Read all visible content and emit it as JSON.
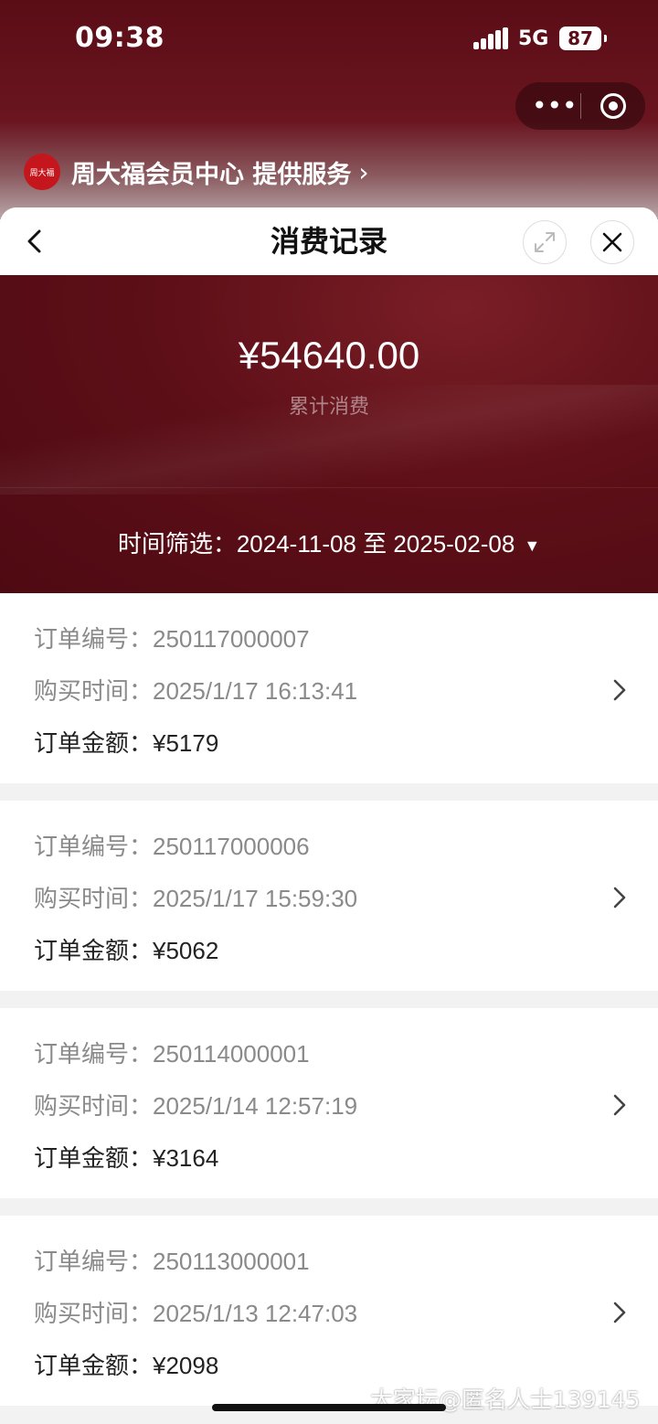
{
  "status_bar": {
    "time": "09:38",
    "network": "5G",
    "battery": "87"
  },
  "provider": {
    "logo_text": "周大福",
    "text": "周大福会员中心 提供服务"
  },
  "navbar": {
    "title": "消费记录"
  },
  "summary": {
    "amount": "¥54640.00",
    "label": "累计消费",
    "filter_label": "时间筛选：",
    "filter_range": "2024-11-08 至 2025-02-08"
  },
  "labels": {
    "order_no": "订单编号：",
    "purchase_time": "购买时间：",
    "order_amount": "订单金额："
  },
  "orders": [
    {
      "number": "250117000007",
      "time": "2025/1/17 16:13:41",
      "amount": "¥5179"
    },
    {
      "number": "250117000006",
      "time": "2025/1/17 15:59:30",
      "amount": "¥5062"
    },
    {
      "number": "250114000001",
      "time": "2025/1/14 12:57:19",
      "amount": "¥3164"
    },
    {
      "number": "250113000001",
      "time": "2025/1/13 12:47:03",
      "amount": "¥2098"
    }
  ],
  "watermark": "大家坛@匿名人士139145",
  "colors": {
    "brand_dark_red": "#5a0d16",
    "logo_red": "#c4161c"
  }
}
